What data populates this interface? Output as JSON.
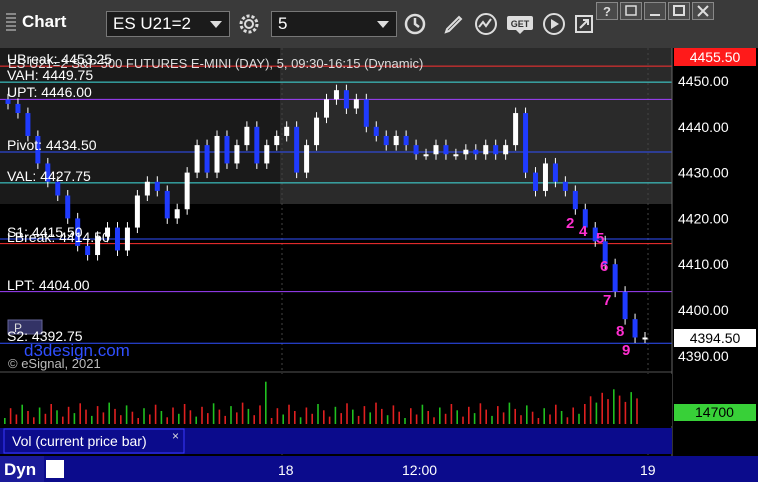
{
  "toolbar": {
    "title": "Chart",
    "symbol": "ES U21=2",
    "interval": "5",
    "get_label": "GET"
  },
  "chart": {
    "header": "ES U21=2 S&P 500 FUTURES E-MINI (DAY), 5, 09:30-16:15 (Dynamic)",
    "copyright": "© eSignal, 2021",
    "watermark": "d3design.com",
    "levels": [
      {
        "label": "UBreak: 4453.25",
        "price": 4453.25,
        "color": "#ff3030"
      },
      {
        "label": "VAH: 4449.75",
        "price": 4449.75,
        "color": "#40e0e0"
      },
      {
        "label": "UPT: 4446.00",
        "price": 4446.0,
        "color": "#a040ff"
      },
      {
        "label": "Pivot: 4434.50",
        "price": 4434.5,
        "color": "#3050ff"
      },
      {
        "label": "VAL: 4427.75",
        "price": 4427.75,
        "color": "#40e0e0"
      },
      {
        "label": "S1: 4415.50",
        "price": 4415.5,
        "color": "#3050ff"
      },
      {
        "label": "LBreak: 4414.50",
        "price": 4414.5,
        "color": "#ff3030"
      },
      {
        "label": "LPT: 4404.00",
        "price": 4404.0,
        "color": "#a040ff"
      },
      {
        "label": "S2: 4392.75",
        "price": 4392.75,
        "color": "#3050ff"
      }
    ],
    "price_axis": [
      "4450.00",
      "4440.00",
      "4430.00",
      "4420.00",
      "4410.00",
      "4400.00",
      "4390.00"
    ],
    "last_price_high": "4455.50",
    "last_price": "4394.50",
    "volume_value": "14700",
    "time_axis": [
      "18",
      "12:00",
      "19"
    ],
    "pane_badge": "P",
    "sequential_labels": [
      "2",
      "4",
      "5",
      "6",
      "7",
      "8",
      "9"
    ]
  },
  "volume_pane": {
    "label": "Vol (current price bar)",
    "close": "×"
  },
  "footer": {
    "mode": "Dyn"
  }
}
